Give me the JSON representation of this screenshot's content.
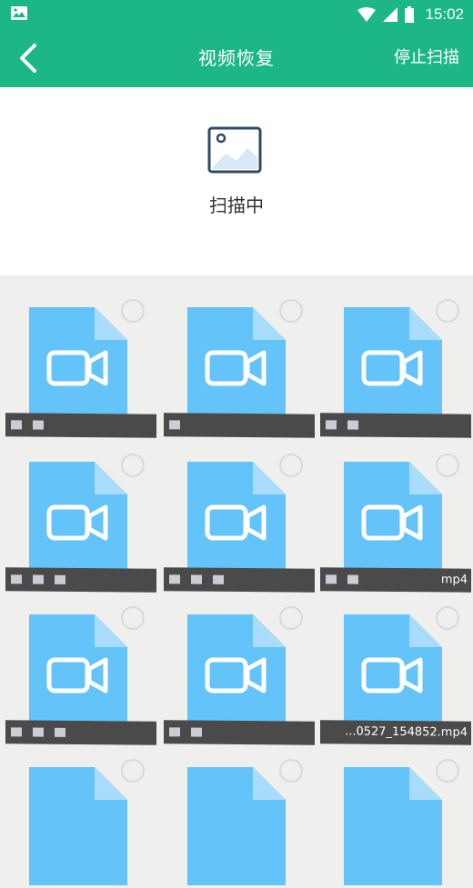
{
  "status_bar": {
    "time": "15:02",
    "icons": [
      "image-icon",
      "wifi-icon",
      "signal-icon",
      "battery-icon"
    ]
  },
  "header": {
    "title": "视频恢复",
    "stop_label": "停止扫描",
    "back_icon": "back-chevron-icon"
  },
  "scan": {
    "status_text": "扫描中",
    "icon": "image-icon"
  },
  "files": [
    {
      "name": ""
    },
    {
      "name": ""
    },
    {
      "name": ""
    },
    {
      "name": ""
    },
    {
      "name": ""
    },
    {
      "name": "mp4"
    },
    {
      "name": ""
    },
    {
      "name": ""
    },
    {
      "name": "...0527_154852.mp4"
    }
  ],
  "colors": {
    "accent": "#1db787",
    "file_icon": "#64c3f8",
    "name_bar": "#4a4a4a"
  }
}
